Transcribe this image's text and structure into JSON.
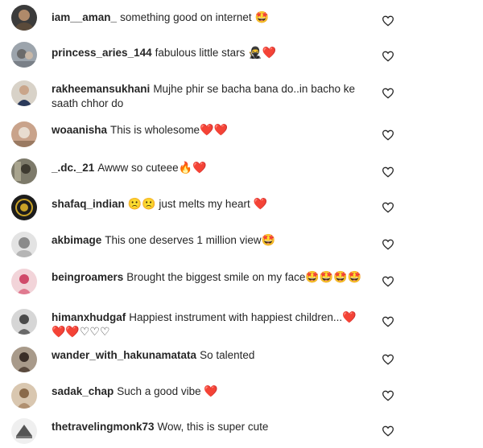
{
  "comments": [
    {
      "username": "iam__aman_",
      "text": "something good on internet",
      "emoji": "🤩",
      "avatar": {
        "bg": "#3b3b3b",
        "fg": "#b08a6a"
      }
    },
    {
      "username": "princess_aries_144",
      "text": "fabulous little stars",
      "emoji": "🥷❤️",
      "avatar": {
        "bg": "#9ca4ac",
        "fg": "#6b6b6b"
      }
    },
    {
      "username": "rakheemansukhani",
      "text": "Mujhe phir se bacha bana do..in bacho ke saath chhor do",
      "emoji": "",
      "avatar": {
        "bg": "#d8d2c8",
        "fg": "#2b3a5a"
      }
    },
    {
      "username": "woaanisha",
      "text": "This is wholesome",
      "emoji": "❤️❤️",
      "avatar": {
        "bg": "#c9a38b",
        "fg": "#e8dcd0"
      }
    },
    {
      "username": "_.dc._21",
      "text": "Awww so cuteee",
      "emoji": "🔥❤️",
      "avatar": {
        "bg": "#7d7a6a",
        "fg": "#3e3a30"
      }
    },
    {
      "username": "shafaq_indian",
      "text": "just melts my heart",
      "emoji_before": "🙁🙁",
      "emoji": "❤️",
      "avatar": {
        "bg": "#1c1c1c",
        "fg": "#c9a227"
      }
    },
    {
      "username": "akbimage",
      "text": "This one deserves 1 million view",
      "emoji": "🤩",
      "avatar": {
        "bg": "#e3e3e3",
        "fg": "#8a8a8a"
      }
    },
    {
      "username": "beingroamers",
      "text": "Brought the biggest smile on my face",
      "emoji": "🤩🤩🤩🤩",
      "avatar": {
        "bg": "#f2d4d9",
        "fg": "#d04a6a"
      }
    },
    {
      "username": "himanxhudgaf",
      "text": "Happiest instrument with happiest children...",
      "emoji": "❤️❤️❤️♡♡♡",
      "avatar": {
        "bg": "#d6d6d6",
        "fg": "#4a4a4a"
      }
    },
    {
      "username": "wander_with_hakunamatata",
      "text": "So talented",
      "emoji": "",
      "avatar": {
        "bg": "#a89a8a",
        "fg": "#3a2e28"
      }
    },
    {
      "username": "sadak_chap",
      "text": "Such a good vibe",
      "emoji": "❤️",
      "avatar": {
        "bg": "#d9c7b0",
        "fg": "#8a6a4a"
      }
    },
    {
      "username": "thetravelingmonk73",
      "text": "Wow, this is super cute",
      "emoji": "",
      "avatar": {
        "bg": "#efefef",
        "fg": "#555555"
      }
    }
  ],
  "icons": {
    "like": "heart-outline-icon"
  },
  "colors": {
    "text": "#262626",
    "heart_red": "#ed1c3a",
    "icon_stroke": "#262626"
  }
}
